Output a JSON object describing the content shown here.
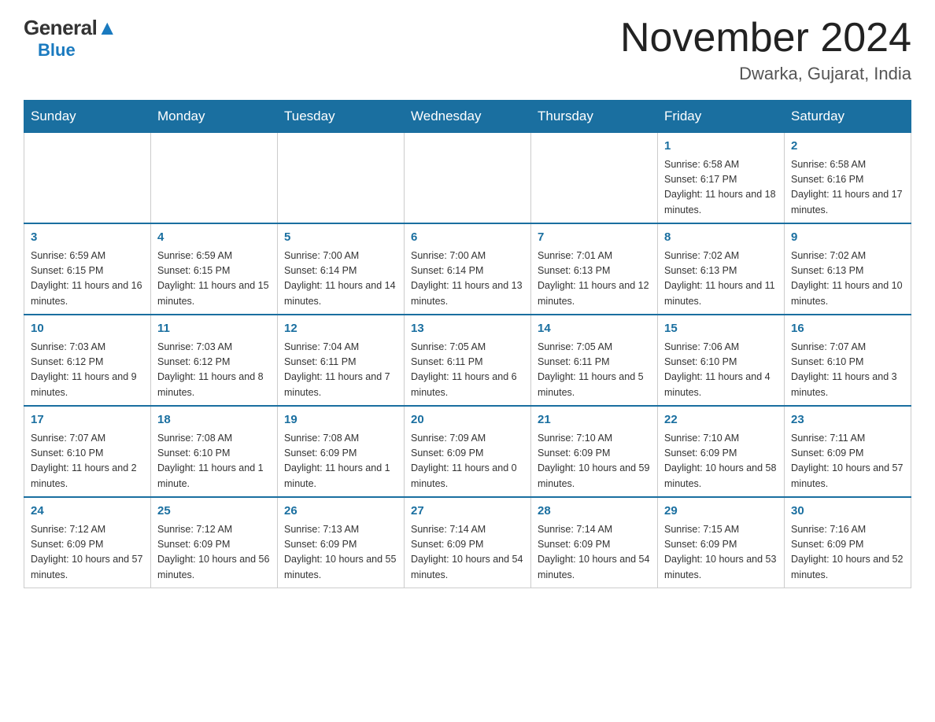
{
  "header": {
    "logo_general": "General",
    "logo_blue": "Blue",
    "month_title": "November 2024",
    "location": "Dwarka, Gujarat, India"
  },
  "weekdays": [
    "Sunday",
    "Monday",
    "Tuesday",
    "Wednesday",
    "Thursday",
    "Friday",
    "Saturday"
  ],
  "weeks": [
    {
      "days": [
        {
          "num": "",
          "sunrise": "",
          "sunset": "",
          "daylight": ""
        },
        {
          "num": "",
          "sunrise": "",
          "sunset": "",
          "daylight": ""
        },
        {
          "num": "",
          "sunrise": "",
          "sunset": "",
          "daylight": ""
        },
        {
          "num": "",
          "sunrise": "",
          "sunset": "",
          "daylight": ""
        },
        {
          "num": "",
          "sunrise": "",
          "sunset": "",
          "daylight": ""
        },
        {
          "num": "1",
          "sunrise": "Sunrise: 6:58 AM",
          "sunset": "Sunset: 6:17 PM",
          "daylight": "Daylight: 11 hours and 18 minutes."
        },
        {
          "num": "2",
          "sunrise": "Sunrise: 6:58 AM",
          "sunset": "Sunset: 6:16 PM",
          "daylight": "Daylight: 11 hours and 17 minutes."
        }
      ]
    },
    {
      "days": [
        {
          "num": "3",
          "sunrise": "Sunrise: 6:59 AM",
          "sunset": "Sunset: 6:15 PM",
          "daylight": "Daylight: 11 hours and 16 minutes."
        },
        {
          "num": "4",
          "sunrise": "Sunrise: 6:59 AM",
          "sunset": "Sunset: 6:15 PM",
          "daylight": "Daylight: 11 hours and 15 minutes."
        },
        {
          "num": "5",
          "sunrise": "Sunrise: 7:00 AM",
          "sunset": "Sunset: 6:14 PM",
          "daylight": "Daylight: 11 hours and 14 minutes."
        },
        {
          "num": "6",
          "sunrise": "Sunrise: 7:00 AM",
          "sunset": "Sunset: 6:14 PM",
          "daylight": "Daylight: 11 hours and 13 minutes."
        },
        {
          "num": "7",
          "sunrise": "Sunrise: 7:01 AM",
          "sunset": "Sunset: 6:13 PM",
          "daylight": "Daylight: 11 hours and 12 minutes."
        },
        {
          "num": "8",
          "sunrise": "Sunrise: 7:02 AM",
          "sunset": "Sunset: 6:13 PM",
          "daylight": "Daylight: 11 hours and 11 minutes."
        },
        {
          "num": "9",
          "sunrise": "Sunrise: 7:02 AM",
          "sunset": "Sunset: 6:13 PM",
          "daylight": "Daylight: 11 hours and 10 minutes."
        }
      ]
    },
    {
      "days": [
        {
          "num": "10",
          "sunrise": "Sunrise: 7:03 AM",
          "sunset": "Sunset: 6:12 PM",
          "daylight": "Daylight: 11 hours and 9 minutes."
        },
        {
          "num": "11",
          "sunrise": "Sunrise: 7:03 AM",
          "sunset": "Sunset: 6:12 PM",
          "daylight": "Daylight: 11 hours and 8 minutes."
        },
        {
          "num": "12",
          "sunrise": "Sunrise: 7:04 AM",
          "sunset": "Sunset: 6:11 PM",
          "daylight": "Daylight: 11 hours and 7 minutes."
        },
        {
          "num": "13",
          "sunrise": "Sunrise: 7:05 AM",
          "sunset": "Sunset: 6:11 PM",
          "daylight": "Daylight: 11 hours and 6 minutes."
        },
        {
          "num": "14",
          "sunrise": "Sunrise: 7:05 AM",
          "sunset": "Sunset: 6:11 PM",
          "daylight": "Daylight: 11 hours and 5 minutes."
        },
        {
          "num": "15",
          "sunrise": "Sunrise: 7:06 AM",
          "sunset": "Sunset: 6:10 PM",
          "daylight": "Daylight: 11 hours and 4 minutes."
        },
        {
          "num": "16",
          "sunrise": "Sunrise: 7:07 AM",
          "sunset": "Sunset: 6:10 PM",
          "daylight": "Daylight: 11 hours and 3 minutes."
        }
      ]
    },
    {
      "days": [
        {
          "num": "17",
          "sunrise": "Sunrise: 7:07 AM",
          "sunset": "Sunset: 6:10 PM",
          "daylight": "Daylight: 11 hours and 2 minutes."
        },
        {
          "num": "18",
          "sunrise": "Sunrise: 7:08 AM",
          "sunset": "Sunset: 6:10 PM",
          "daylight": "Daylight: 11 hours and 1 minute."
        },
        {
          "num": "19",
          "sunrise": "Sunrise: 7:08 AM",
          "sunset": "Sunset: 6:09 PM",
          "daylight": "Daylight: 11 hours and 1 minute."
        },
        {
          "num": "20",
          "sunrise": "Sunrise: 7:09 AM",
          "sunset": "Sunset: 6:09 PM",
          "daylight": "Daylight: 11 hours and 0 minutes."
        },
        {
          "num": "21",
          "sunrise": "Sunrise: 7:10 AM",
          "sunset": "Sunset: 6:09 PM",
          "daylight": "Daylight: 10 hours and 59 minutes."
        },
        {
          "num": "22",
          "sunrise": "Sunrise: 7:10 AM",
          "sunset": "Sunset: 6:09 PM",
          "daylight": "Daylight: 10 hours and 58 minutes."
        },
        {
          "num": "23",
          "sunrise": "Sunrise: 7:11 AM",
          "sunset": "Sunset: 6:09 PM",
          "daylight": "Daylight: 10 hours and 57 minutes."
        }
      ]
    },
    {
      "days": [
        {
          "num": "24",
          "sunrise": "Sunrise: 7:12 AM",
          "sunset": "Sunset: 6:09 PM",
          "daylight": "Daylight: 10 hours and 57 minutes."
        },
        {
          "num": "25",
          "sunrise": "Sunrise: 7:12 AM",
          "sunset": "Sunset: 6:09 PM",
          "daylight": "Daylight: 10 hours and 56 minutes."
        },
        {
          "num": "26",
          "sunrise": "Sunrise: 7:13 AM",
          "sunset": "Sunset: 6:09 PM",
          "daylight": "Daylight: 10 hours and 55 minutes."
        },
        {
          "num": "27",
          "sunrise": "Sunrise: 7:14 AM",
          "sunset": "Sunset: 6:09 PM",
          "daylight": "Daylight: 10 hours and 54 minutes."
        },
        {
          "num": "28",
          "sunrise": "Sunrise: 7:14 AM",
          "sunset": "Sunset: 6:09 PM",
          "daylight": "Daylight: 10 hours and 54 minutes."
        },
        {
          "num": "29",
          "sunrise": "Sunrise: 7:15 AM",
          "sunset": "Sunset: 6:09 PM",
          "daylight": "Daylight: 10 hours and 53 minutes."
        },
        {
          "num": "30",
          "sunrise": "Sunrise: 7:16 AM",
          "sunset": "Sunset: 6:09 PM",
          "daylight": "Daylight: 10 hours and 52 minutes."
        }
      ]
    }
  ]
}
